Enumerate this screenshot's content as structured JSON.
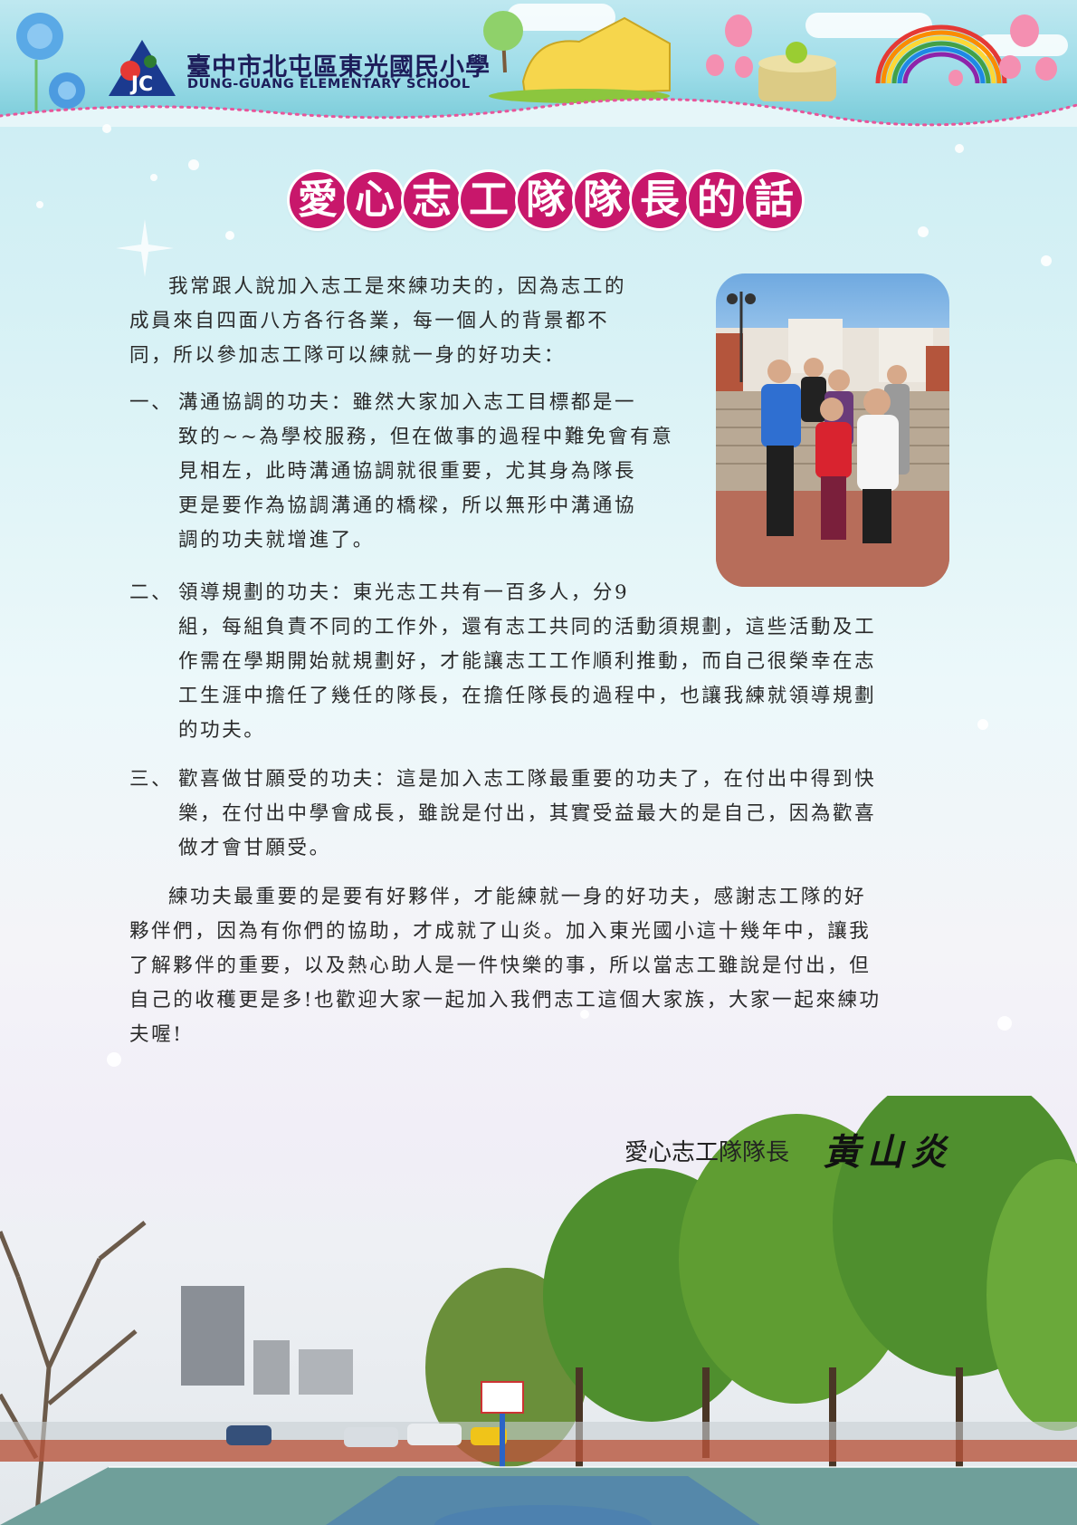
{
  "school": {
    "name_zh": "臺中市北屯區東光國民小學",
    "name_en": "DUNG-GUANG ELEMENTARY SCHOOL",
    "logo_text": "JC"
  },
  "title": {
    "chars": [
      "愛",
      "心",
      "志",
      "工",
      "隊",
      "隊",
      "長",
      "的",
      "話"
    ]
  },
  "photo": {
    "description_icon": "family-photo-icon"
  },
  "content": {
    "intro_lines": [
      "我常跟人說加入志工是來練功夫的，因為志工的",
      "成員來自四面八方各行各業，每一個人的背景都不",
      "同，所以參加志工隊可以練就一身的好功夫："
    ],
    "items": [
      {
        "number": "一、",
        "lines": [
          "溝通協調的功夫：雖然大家加入志工目標都是一",
          "致的~~為學校服務，但在做事的過程中難免會有意",
          "見相左，此時溝通協調就很重要，尤其身為隊長",
          "更是要作為協調溝通的橋樑，所以無形中溝通協",
          "調的功夫就增進了。"
        ]
      },
      {
        "number": "二、",
        "lines": [
          "領導規劃的功夫：東光志工共有一百多人，分9",
          "組，每組負責不同的工作外，還有志工共同的活動須規劃，這些活動及工",
          "作需在學期開始就規劃好，才能讓志工工作順利推動，而自己很榮幸在志",
          "工生涯中擔任了幾任的隊長，在擔任隊長的過程中，也讓我練就領導規劃",
          "的功夫。"
        ]
      },
      {
        "number": "三、",
        "lines": [
          "歡喜做甘願受的功夫：這是加入志工隊最重要的功夫了，在付出中得到快",
          "樂，在付出中學會成長，雖說是付出，其實受益最大的是自己，因為歡喜",
          "做才會甘願受。"
        ]
      }
    ],
    "closing_lines": [
      "練功夫最重要的是要有好夥伴，才能練就一身的好功夫，感謝志工隊的好",
      "夥伴們，因為有你們的協助，才成就了山炎。加入東光國小這十幾年中，讓我",
      "了解夥伴的重要，以及熱心助人是一件快樂的事，所以當志工雖說是付出，但",
      "自己的收穫更是多!也歡迎大家一起加入我們志工這個大家族，大家一起來練功",
      "夫喔!"
    ]
  },
  "signature": {
    "role": "愛心志工隊隊長",
    "name": "黃山炎"
  },
  "colors": {
    "title_bg": "#c8176b",
    "header_text": "#1d1d5a"
  }
}
